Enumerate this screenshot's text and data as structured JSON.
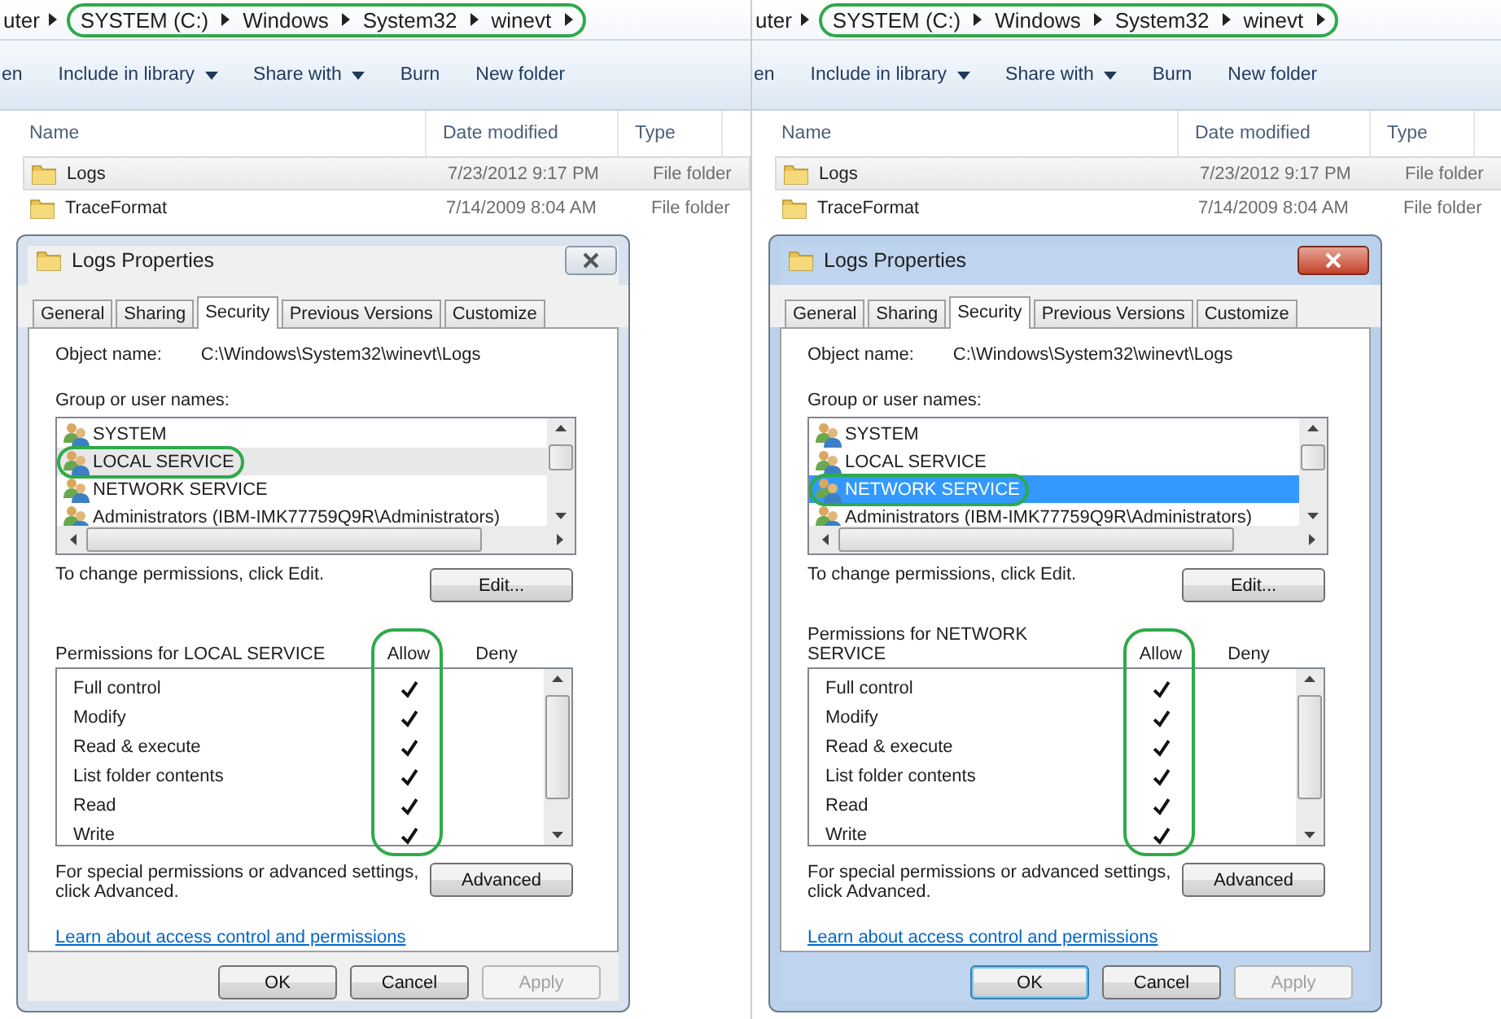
{
  "panels": [
    {
      "breadcrumb": {
        "circled": true,
        "items": [
          "uter",
          "SYSTEM (C:)",
          "Windows",
          "System32",
          "winevt"
        ]
      },
      "toolbar": [
        {
          "label": "en",
          "dropdown": false
        },
        {
          "label": "Include in library",
          "dropdown": true
        },
        {
          "label": "Share with",
          "dropdown": true
        },
        {
          "label": "Burn",
          "dropdown": false
        },
        {
          "label": "New folder",
          "dropdown": false
        }
      ],
      "columns": [
        "Name",
        "Date modified",
        "Type"
      ],
      "files": [
        {
          "name": "Logs",
          "date": "7/23/2012 9:17 PM",
          "type": "File folder",
          "selected": true
        },
        {
          "name": "TraceFormat",
          "date": "7/14/2009 8:04 AM",
          "type": "File folder",
          "selected": false
        }
      ],
      "dialog": {
        "title": "Logs Properties",
        "active": false,
        "tabs": [
          {
            "label": "General",
            "selected": false
          },
          {
            "label": "Sharing",
            "selected": false
          },
          {
            "label": "Security",
            "selected": true
          },
          {
            "label": "Previous Versions",
            "selected": false
          },
          {
            "label": "Customize",
            "selected": false
          }
        ],
        "object_label": "Object name:",
        "object_value": "C:\\Windows\\System32\\winevt\\Logs",
        "group_label": "Group or user names:",
        "groups": [
          {
            "name": "SYSTEM",
            "selected": false,
            "circled": false
          },
          {
            "name": "LOCAL SERVICE",
            "selected": true,
            "circled": true
          },
          {
            "name": "NETWORK SERVICE",
            "selected": false,
            "circled": false
          },
          {
            "name": "Administrators (IBM-IMK77759Q9R\\Administrators)",
            "selected": false,
            "circled": false
          }
        ],
        "change_text": "To change permissions, click Edit.",
        "edit_button": "Edit...",
        "permissions_label": "Permissions for LOCAL SERVICE",
        "allow_label": "Allow",
        "deny_label": "Deny",
        "allow_circled": true,
        "permissions": [
          {
            "name": "Full control",
            "allow": true,
            "deny": false
          },
          {
            "name": "Modify",
            "allow": true,
            "deny": false
          },
          {
            "name": "Read & execute",
            "allow": true,
            "deny": false
          },
          {
            "name": "List folder contents",
            "allow": true,
            "deny": false
          },
          {
            "name": "Read",
            "allow": true,
            "deny": false
          },
          {
            "name": "Write",
            "allow": true,
            "deny": false
          }
        ],
        "special_text": "For special permissions or advanced settings, click Advanced.",
        "advanced_button": "Advanced",
        "link": "Learn about access control and permissions",
        "buttons": [
          {
            "label": "OK",
            "disabled": false,
            "focused": false
          },
          {
            "label": "Cancel",
            "disabled": false,
            "focused": false
          },
          {
            "label": "Apply",
            "disabled": true,
            "focused": false
          }
        ]
      }
    },
    {
      "breadcrumb": {
        "circled": true,
        "items": [
          "uter",
          "SYSTEM (C:)",
          "Windows",
          "System32",
          "winevt"
        ]
      },
      "toolbar": [
        {
          "label": "en",
          "dropdown": false
        },
        {
          "label": "Include in library",
          "dropdown": true
        },
        {
          "label": "Share with",
          "dropdown": true
        },
        {
          "label": "Burn",
          "dropdown": false
        },
        {
          "label": "New folder",
          "dropdown": false
        }
      ],
      "columns": [
        "Name",
        "Date modified",
        "Type"
      ],
      "files": [
        {
          "name": "Logs",
          "date": "7/23/2012 9:17 PM",
          "type": "File folder",
          "selected": true
        },
        {
          "name": "TraceFormat",
          "date": "7/14/2009 8:04 AM",
          "type": "File folder",
          "selected": false
        }
      ],
      "dialog": {
        "title": "Logs Properties",
        "active": true,
        "tabs": [
          {
            "label": "General",
            "selected": false
          },
          {
            "label": "Sharing",
            "selected": false
          },
          {
            "label": "Security",
            "selected": true
          },
          {
            "label": "Previous Versions",
            "selected": false
          },
          {
            "label": "Customize",
            "selected": false
          }
        ],
        "object_label": "Object name:",
        "object_value": "C:\\Windows\\System32\\winevt\\Logs",
        "group_label": "Group or user names:",
        "groups": [
          {
            "name": "SYSTEM",
            "selected": false,
            "circled": false
          },
          {
            "name": "LOCAL SERVICE",
            "selected": false,
            "circled": false
          },
          {
            "name": "NETWORK SERVICE",
            "selected": true,
            "circled": true
          },
          {
            "name": "Administrators (IBM-IMK77759Q9R\\Administrators)",
            "selected": false,
            "circled": false
          }
        ],
        "change_text": "To change permissions, click Edit.",
        "edit_button": "Edit...",
        "permissions_label": "Permissions for NETWORK SERVICE",
        "allow_label": "Allow",
        "deny_label": "Deny",
        "allow_circled": true,
        "permissions": [
          {
            "name": "Full control",
            "allow": true,
            "deny": false
          },
          {
            "name": "Modify",
            "allow": true,
            "deny": false
          },
          {
            "name": "Read & execute",
            "allow": true,
            "deny": false
          },
          {
            "name": "List folder contents",
            "allow": true,
            "deny": false
          },
          {
            "name": "Read",
            "allow": true,
            "deny": false
          },
          {
            "name": "Write",
            "allow": true,
            "deny": false
          }
        ],
        "special_text": "For special permissions or advanced settings, click Advanced.",
        "advanced_button": "Advanced",
        "link": "Learn about access control and permissions",
        "buttons": [
          {
            "label": "OK",
            "disabled": false,
            "focused": true
          },
          {
            "label": "Cancel",
            "disabled": false,
            "focused": false
          },
          {
            "label": "Apply",
            "disabled": true,
            "focused": false
          }
        ]
      }
    }
  ]
}
